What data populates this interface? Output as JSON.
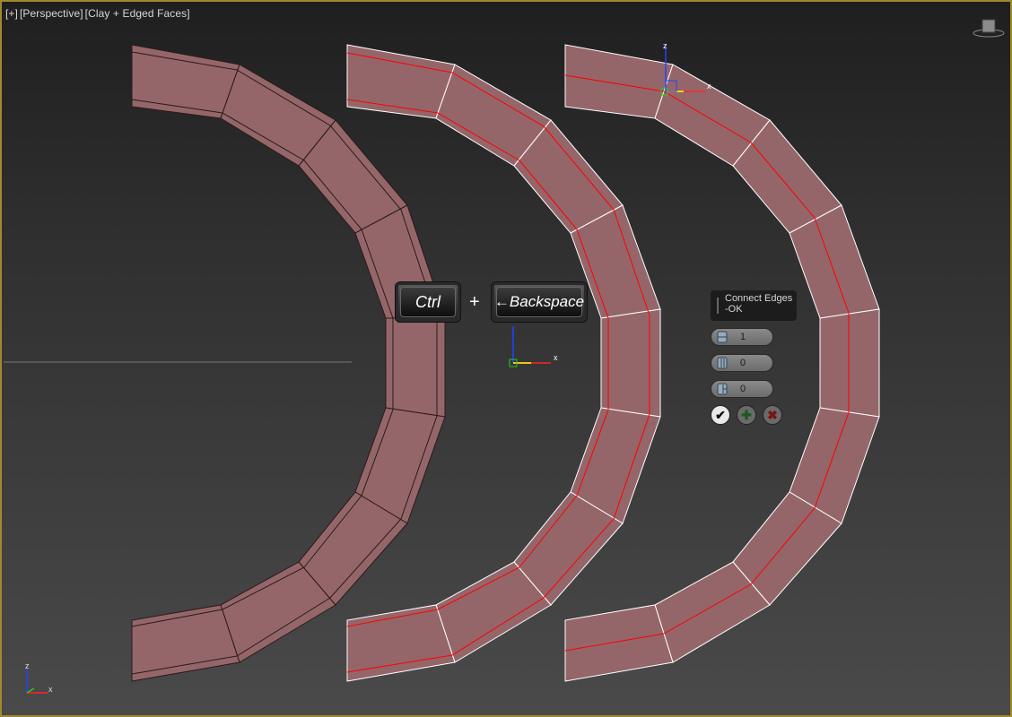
{
  "viewport": {
    "label_parts": [
      "[+]",
      "[Perspective]",
      "[Clay + Edged Faces]"
    ]
  },
  "keys": {
    "ctrl": "Ctrl",
    "plus": "+",
    "backspace": "←Backspace"
  },
  "caddy": {
    "title_line1": "Connect Edges",
    "title_line2": "-OK",
    "segments_value": "1",
    "pinch_value": "0",
    "slide_value": "0",
    "icons": [
      "segments-icon",
      "pinch-icon",
      "slide-icon",
      "checkmark-icon",
      "plus-icon",
      "x-icon"
    ]
  },
  "gizmo_labels": {
    "x": "x",
    "y": "y",
    "z": "z"
  },
  "colors": {
    "mesh_fill": "#94666a",
    "selected_edge": "#ff0000",
    "wire_dark": "#2a1a1a",
    "wire_white": "#ffffff",
    "viewport_border": "#a08a2a"
  }
}
